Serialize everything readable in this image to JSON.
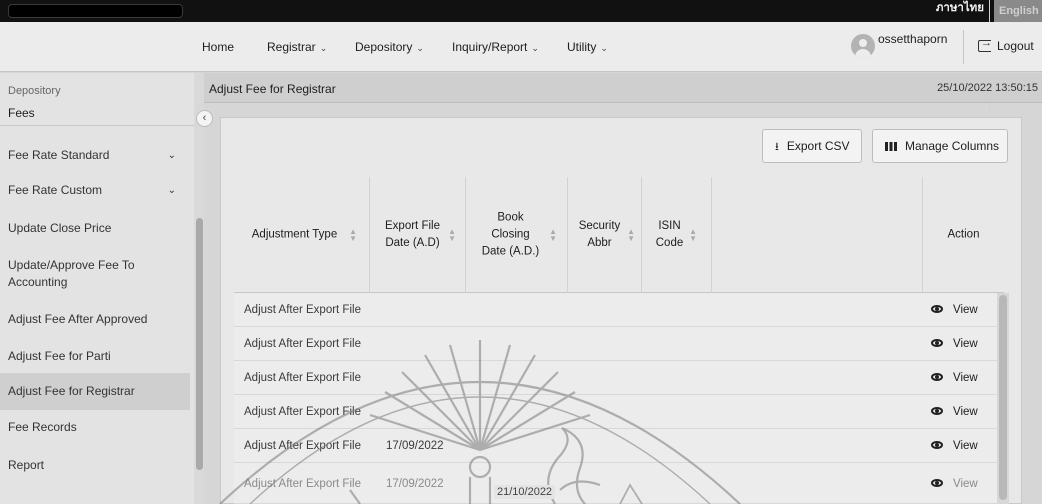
{
  "language": {
    "thai": "ภาษาไทย",
    "english": "English"
  },
  "nav": {
    "home": "Home",
    "registrar": "Registrar",
    "depository": "Depository",
    "inquiry_report": "Inquiry/Report",
    "utility": "Utility",
    "user": "ossetthaporn",
    "logout": "Logout"
  },
  "sidebar": {
    "crumb": "Depository",
    "section": "Fees",
    "items": [
      {
        "label": "Fee Rate Standard",
        "expandable": true
      },
      {
        "label": "Fee Rate Custom",
        "expandable": true
      },
      {
        "label": "Update Close Price"
      },
      {
        "label": "Update/Approve Fee To Accounting"
      },
      {
        "label": "Adjust Fee After Approved"
      },
      {
        "label": "Adjust Fee for Parti"
      },
      {
        "label": "Adjust Fee for Registrar",
        "active": true
      },
      {
        "label": "Fee Records"
      },
      {
        "label": "Report"
      }
    ]
  },
  "page": {
    "title": "Adjust Fee for Registrar",
    "datetime": "25/10/2022 13:50:15"
  },
  "toolbar": {
    "export_csv": "Export CSV",
    "manage_columns": "Manage Columns"
  },
  "table": {
    "headers": {
      "adjustment_type": "Adjustment Type",
      "export_file_date": "Export File Date (A.D)",
      "book_closing_date": "Book Closing Date (A.D.)",
      "security_abbr": "Security Abbr",
      "isin_code": "ISIN Code",
      "action": "Action"
    },
    "rows": [
      {
        "adjustment_type": "Adjust After Export File",
        "export_file_date": "",
        "view": "View"
      },
      {
        "adjustment_type": "Adjust After Export File",
        "export_file_date": "",
        "view": "View"
      },
      {
        "adjustment_type": "Adjust After Export File",
        "export_file_date": "",
        "view": "View"
      },
      {
        "adjustment_type": "Adjust After Export File",
        "export_file_date": "",
        "view": "View"
      },
      {
        "adjustment_type": "Adjust After Export File",
        "export_file_date": "17/09/2022",
        "view": "View"
      },
      {
        "adjustment_type": "Adjust After Export File",
        "export_file_date": "17/09/2022",
        "view": "View"
      }
    ]
  },
  "footer": {
    "date": "21/10/2022"
  }
}
